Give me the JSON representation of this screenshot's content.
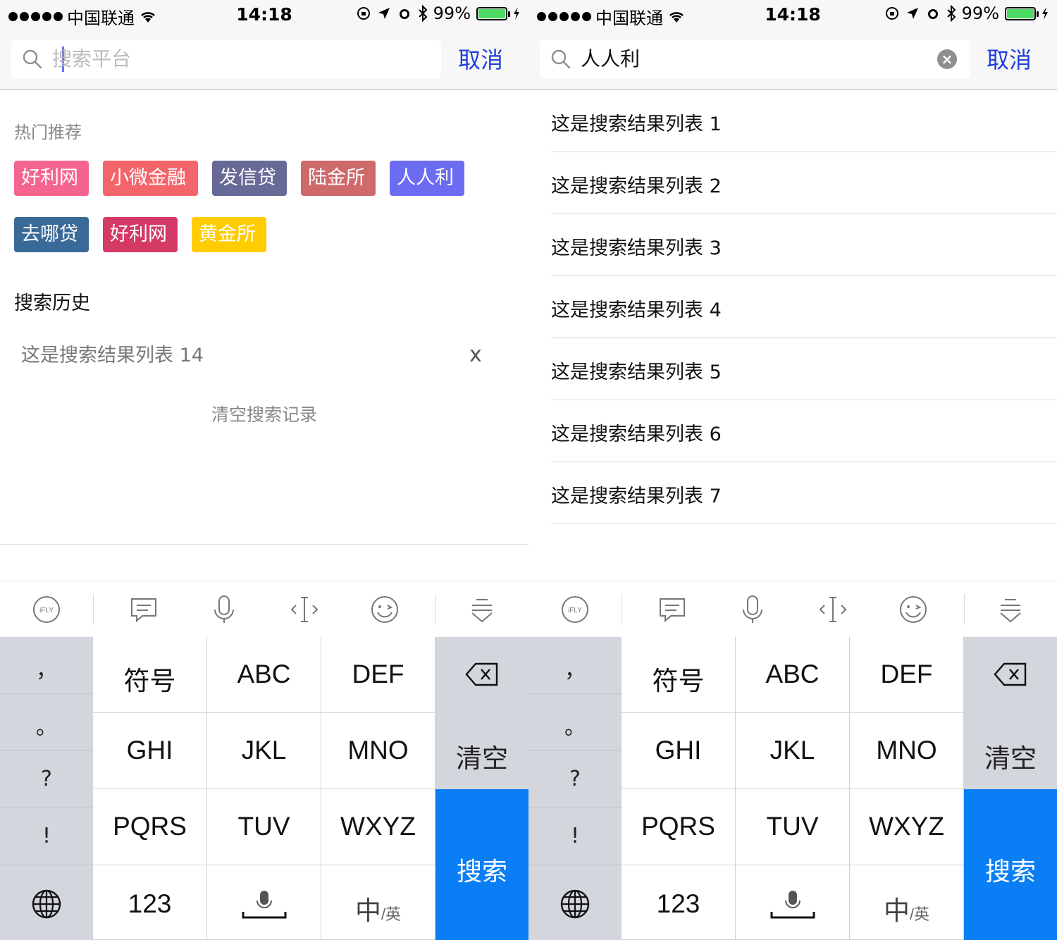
{
  "status_bar": {
    "carrier": "中国联通",
    "time": "14:18",
    "battery": "99%"
  },
  "left_screen": {
    "search_placeholder": "搜索平台",
    "cancel_label": "取消",
    "hot_title": "热门推荐",
    "hot_tags": [
      {
        "label": "好利网",
        "color": "#f5648f"
      },
      {
        "label": "小微金融",
        "color": "#f4646b"
      },
      {
        "label": "发信贷",
        "color": "#676a96"
      },
      {
        "label": "陆金所",
        "color": "#cf6a6a"
      },
      {
        "label": "人人利",
        "color": "#6c6cf2"
      },
      {
        "label": "去哪贷",
        "color": "#3a6a98"
      },
      {
        "label": "好利网",
        "color": "#d43a66"
      },
      {
        "label": "黄金所",
        "color": "#ffcc00"
      }
    ],
    "history_title": "搜索历史",
    "history_items": [
      "这是搜索结果列表 14"
    ],
    "history_delete": "x",
    "clear_history": "清空搜索记录"
  },
  "right_screen": {
    "search_value": "人人利",
    "cancel_label": "取消",
    "results": [
      "这是搜索结果列表 1",
      "这是搜索结果列表 2",
      "这是搜索结果列表 3",
      "这是搜索结果列表 4",
      "这是搜索结果列表 5",
      "这是搜索结果列表 6",
      "这是搜索结果列表 7"
    ]
  },
  "keyboard": {
    "toolbar_icons": [
      "ifly-logo-icon",
      "message-icon",
      "microphone-icon",
      "cursor-move-icon",
      "emoji-icon",
      "hide-keyboard-icon"
    ],
    "ifly_label": "iFLY",
    "punctuation": [
      "，",
      "。",
      "?",
      "!"
    ],
    "keys_row1": [
      "符号",
      "ABC",
      "DEF"
    ],
    "keys_row2": [
      "GHI",
      "JKL",
      "MNO"
    ],
    "keys_row3": [
      "PQRS",
      "TUV",
      "WXYZ"
    ],
    "key_123": "123",
    "key_lang_main": "中",
    "key_lang_sub": "/英",
    "key_clear": "清空",
    "key_search": "搜索",
    "accent_color": "#0a7ef5"
  }
}
